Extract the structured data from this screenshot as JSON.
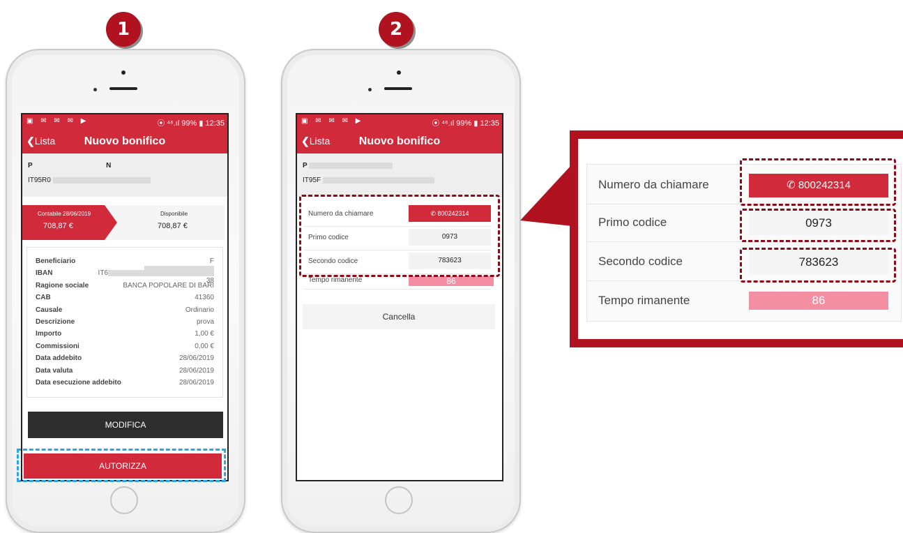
{
  "steps": {
    "one": "1",
    "two": "2"
  },
  "colors": {
    "brand_red": "#d02a3b",
    "callout_red": "#b0121f",
    "dark_button": "#2d2d2d",
    "highlight_blue": "#29a6e8",
    "timer_pink": "#f48ea2"
  },
  "statusbar": {
    "icons": "▣ ✉ ✉ ✉ ▶",
    "signal": "⦿ ⁴⁶.ıl 99% ▮ 12:35"
  },
  "screen1": {
    "back_label": "Lista",
    "title": "Nuovo bonifico",
    "payer_name_start": "P",
    "payer_name_end": "N",
    "iban_start": "IT95R0",
    "balance": {
      "contabile_label": "Contabile 28/06/2019",
      "contabile_value": "708,87 €",
      "disponibile_label": "Disponibile",
      "disponibile_value": "708,87 €"
    },
    "details": [
      {
        "label": "Beneficiario",
        "value": "F"
      },
      {
        "label": "IBAN",
        "value": "IT6",
        "value_end": "38"
      },
      {
        "label": "Ragione sociale",
        "value": "BANCA POPOLARE DI BARI"
      },
      {
        "label": "CAB",
        "value": "41360"
      },
      {
        "label": "Causale",
        "value": "Ordinario"
      },
      {
        "label": "Descrizione",
        "value": "prova"
      },
      {
        "label": "Importo",
        "value": "1,00 €"
      },
      {
        "label": "Commissioni",
        "value": "0,00 €"
      },
      {
        "label": "Data addebito",
        "value": "28/06/2019"
      },
      {
        "label": "Data valuta",
        "value": "28/06/2019"
      },
      {
        "label": "Data esecuzione addebito",
        "value": "28/06/2019"
      }
    ],
    "modifica_label": "MODIFICA",
    "autorizza_label": "AUTORIZZA"
  },
  "screen2": {
    "back_label": "Lista",
    "title": "Nuovo bonifico",
    "payer_start": "P",
    "iban_start": "IT95F",
    "numero_label": "Numero da chiamare",
    "numero_value": "800242314",
    "primo_label": "Primo codice",
    "primo_value": "0973",
    "secondo_label": "Secondo codice",
    "secondo_value": "783623",
    "tempo_label": "Tempo rimanente",
    "tempo_value": "86",
    "cancella_label": "Cancella"
  },
  "zoom": {
    "numero_label": "Numero da chiamare",
    "numero_value": "800242314",
    "primo_label": "Primo codice",
    "primo_value": "0973",
    "secondo_label": "Secondo codice",
    "secondo_value": "783623",
    "tempo_label": "Tempo rimanente",
    "tempo_value": "86"
  }
}
